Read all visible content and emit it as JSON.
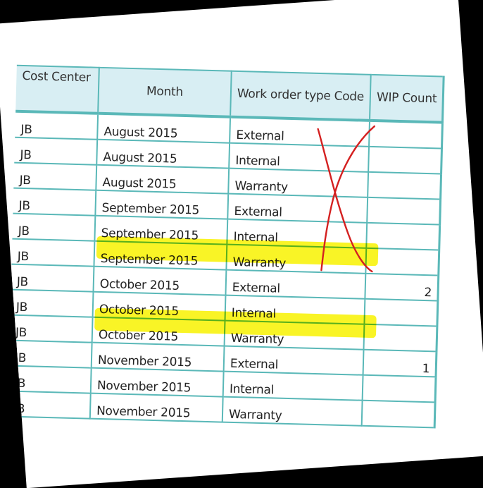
{
  "table": {
    "headers": [
      "Cost Center",
      "Month",
      "Work order type Code",
      "WIP Count"
    ],
    "rows": [
      {
        "cost_center": "JB",
        "month": "August 2015",
        "type": "External",
        "wip": ""
      },
      {
        "cost_center": "JB",
        "month": "August 2015",
        "type": "Internal",
        "wip": ""
      },
      {
        "cost_center": "JB",
        "month": "August 2015",
        "type": "Warranty",
        "wip": ""
      },
      {
        "cost_center": "JB",
        "month": "September 2015",
        "type": "External",
        "wip": ""
      },
      {
        "cost_center": "JB",
        "month": "September 2015",
        "type": "Internal",
        "wip": ""
      },
      {
        "cost_center": "JB",
        "month": "September 2015",
        "type": "Warranty",
        "wip": ""
      },
      {
        "cost_center": "JB",
        "month": "October 2015",
        "type": "External",
        "wip": "2"
      },
      {
        "cost_center": "JB",
        "month": "October 2015",
        "type": "Internal",
        "wip": ""
      },
      {
        "cost_center": "JB",
        "month": "October 2015",
        "type": "Warranty",
        "wip": ""
      },
      {
        "cost_center": "JB",
        "month": "November 2015",
        "type": "External",
        "wip": "1"
      },
      {
        "cost_center": "JB",
        "month": "November 2015",
        "type": "Internal",
        "wip": ""
      },
      {
        "cost_center": "JB",
        "month": "November 2015",
        "type": "Warranty",
        "wip": ""
      }
    ]
  },
  "annotations": {
    "cross_out_color": "#d42020",
    "highlight_color": "#f8f200"
  }
}
